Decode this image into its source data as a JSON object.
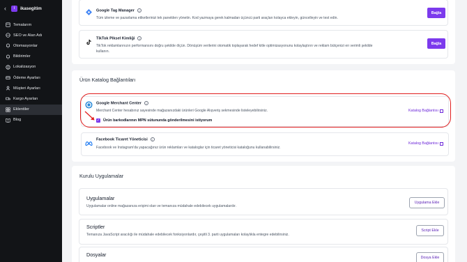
{
  "sidebar": {
    "back_icon": "chevron-left-icon",
    "brand": "ikasegitim",
    "items": [
      {
        "label": "Temalarım",
        "icon": "template-icon",
        "active": false
      },
      {
        "label": "SEO ve Alan Adı",
        "icon": "globe-icon",
        "active": false
      },
      {
        "label": "Otomasyonlar",
        "icon": "bell-icon",
        "active": false
      },
      {
        "label": "Bildirimler",
        "icon": "bell-icon",
        "active": false
      },
      {
        "label": "Lokalizasyon",
        "icon": "globe-icon",
        "active": false
      },
      {
        "label": "Ödeme Ayarları",
        "icon": "card-icon",
        "active": false
      },
      {
        "label": "Müşteri Ayarları",
        "icon": "users-icon",
        "active": false
      },
      {
        "label": "Kargo Ayarları",
        "icon": "truck-icon",
        "active": false
      },
      {
        "label": "Eklentiler",
        "icon": "grid-icon",
        "active": true
      },
      {
        "label": "Blog",
        "icon": "book-icon",
        "active": false
      }
    ]
  },
  "marketing": {
    "gtm": {
      "title": "Google Tag Manager",
      "desc": "Tüm izleme ve pazarlama etiketlerinizi tek panelden yönetin. Kod yazmaya gerek kalmadan üçüncü parti araçları kolayca ekleyin, güncelleyin ve test edin.",
      "button": "Bağla"
    },
    "tiktok": {
      "title": "TikTok Piksel Kimliği",
      "desc": "TikTok reklamlarınızın performansını doğru şekilde ölçün. Dönüşüm verilerini otomatik toplayarak hedef kitle optimizasyonunu kolaylaştırın ve reklam bütçenizi en verimli şekilde kullanın.",
      "button": "Bağla"
    }
  },
  "catalog": {
    "section_title": "Ürün Katalog Bağlantıları",
    "merchant": {
      "title": "Google Merchant Center",
      "desc": "Merchant Center hesabınız sayesinde mağazanızdaki ürünleri Google Alışveriş sekmesinde listeleyebilirsiniz.",
      "link": "Katalog Bağlantısı",
      "checkbox_label": "Ürün barkodlarının MPN sütununda gönderilmesini istiyorum",
      "checkbox_checked": true
    },
    "facebook": {
      "title": "Facebook Ticaret Yöneticisi",
      "desc": "Facebook ve Instagram'da yapacağınız ürün reklamları ve kataloglar için ticaret yöneticisi kataloğunu kullanabilirsiniz.",
      "link": "Katalog Bağlantısı"
    }
  },
  "installed": {
    "section_title": "Kurulu Uygulamalar",
    "apps": {
      "title": "Uygulamalar",
      "desc": "Uygulamalar online mağazanıza erişimi olan ve temanıza müdahale edebilecek uygulamalardır.",
      "button": "Uygulama Ekle"
    },
    "scripts": {
      "title": "Scriptler",
      "desc": "Temanıza JavaScript aracılığı ile müdahale edebilecek fonksiyonlardır, çeşitli 3. parti uygulamaları kolaylıkla entegre edebilirsiniz.",
      "button": "Script Ekle"
    },
    "files": {
      "title": "Dosyalar",
      "button": "Dosya Ekle"
    }
  },
  "colors": {
    "accent": "#7c3aed",
    "annotation": "#e11d1d",
    "sidebar_bg": "#121417"
  }
}
